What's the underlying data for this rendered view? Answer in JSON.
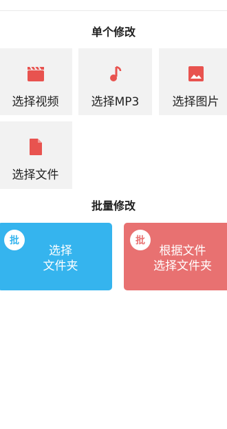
{
  "single_section": {
    "title": "单个修改",
    "tiles": [
      {
        "label": "选择视频",
        "icon": "video-clapper-icon"
      },
      {
        "label": "选择MP3",
        "icon": "music-note-icon"
      },
      {
        "label": "选择图片",
        "icon": "image-icon"
      },
      {
        "label": "选择文件",
        "icon": "file-icon"
      }
    ]
  },
  "batch_section": {
    "title": "批量修改",
    "cards": [
      {
        "badge": "批",
        "line1": "选择",
        "line2": "文件夹",
        "color": "#35b4ee"
      },
      {
        "badge": "批",
        "line1": "根据文件",
        "line2": "选择文件夹",
        "color": "#e87171"
      }
    ]
  },
  "colors": {
    "icon_red": "#e8534f",
    "tile_bg": "#f2f2f2"
  }
}
